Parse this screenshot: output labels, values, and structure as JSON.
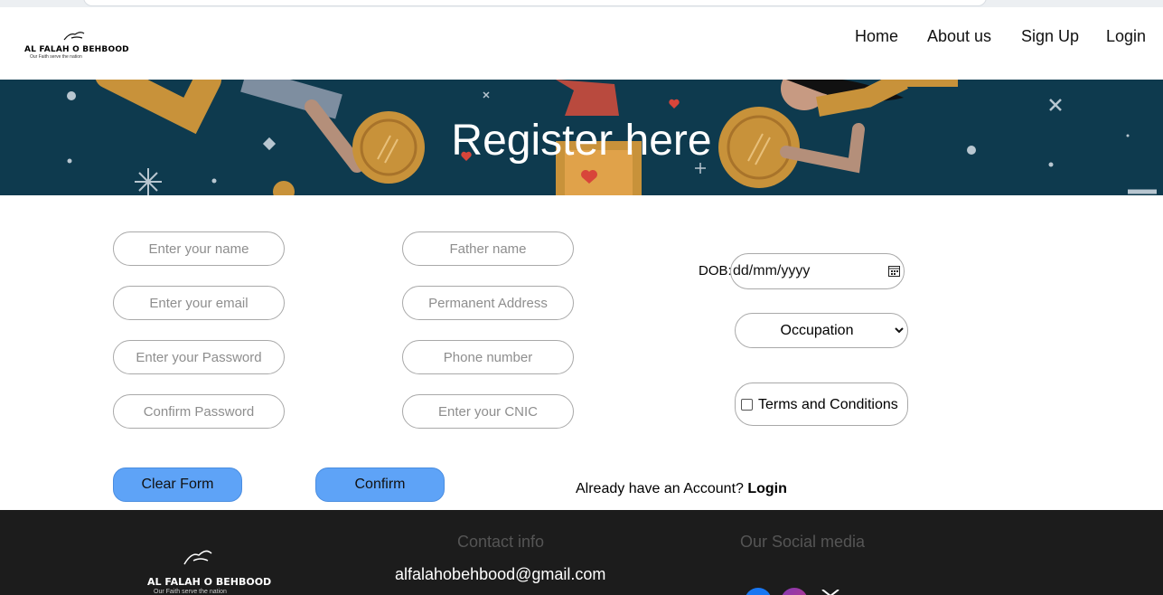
{
  "header": {
    "logo": {
      "brand": "AL FALAH O BEHBOOD",
      "tagline": "Our Faith serve the nation"
    },
    "nav": [
      {
        "label": "Home"
      },
      {
        "label": "About us"
      },
      {
        "label": "Sign Up"
      },
      {
        "label": "Login"
      }
    ]
  },
  "hero": {
    "title": "Register here"
  },
  "form": {
    "col1": [
      "Enter your name",
      "Enter your email",
      "Enter your Password",
      "Confirm Password"
    ],
    "col2": [
      "Father name",
      "Permanent Address",
      "Phone number",
      "Enter your CNIC"
    ],
    "dob": {
      "label": "DOB:",
      "placeholder": "dd/mm/yyyy"
    },
    "occupation": {
      "selected": "Occupation"
    },
    "terms": {
      "label": "Terms and Conditions",
      "checked": false
    },
    "buttons": {
      "clear": "Clear Form",
      "confirm": "Confirm"
    },
    "already": {
      "text": "Already have an Account?",
      "link": "Login"
    }
  },
  "footer": {
    "logo": {
      "brand": "AL FALAH O BEHBOOD",
      "tagline": "Our Faith serve the nation"
    },
    "contact_heading": "Contact info",
    "email": "alfalahobehbood@gmail.com",
    "social_heading": "Our Social media",
    "social": [
      {
        "icon": "facebook-icon",
        "color": "#1877f2"
      },
      {
        "icon": "instagram-icon",
        "color": "#c13584"
      },
      {
        "icon": "x-icon",
        "color": "#ffffff"
      }
    ]
  },
  "colors": {
    "hero_bg": "#0e3a4e",
    "button": "#5ea3f7",
    "footer_bg": "#1c1c1c"
  }
}
